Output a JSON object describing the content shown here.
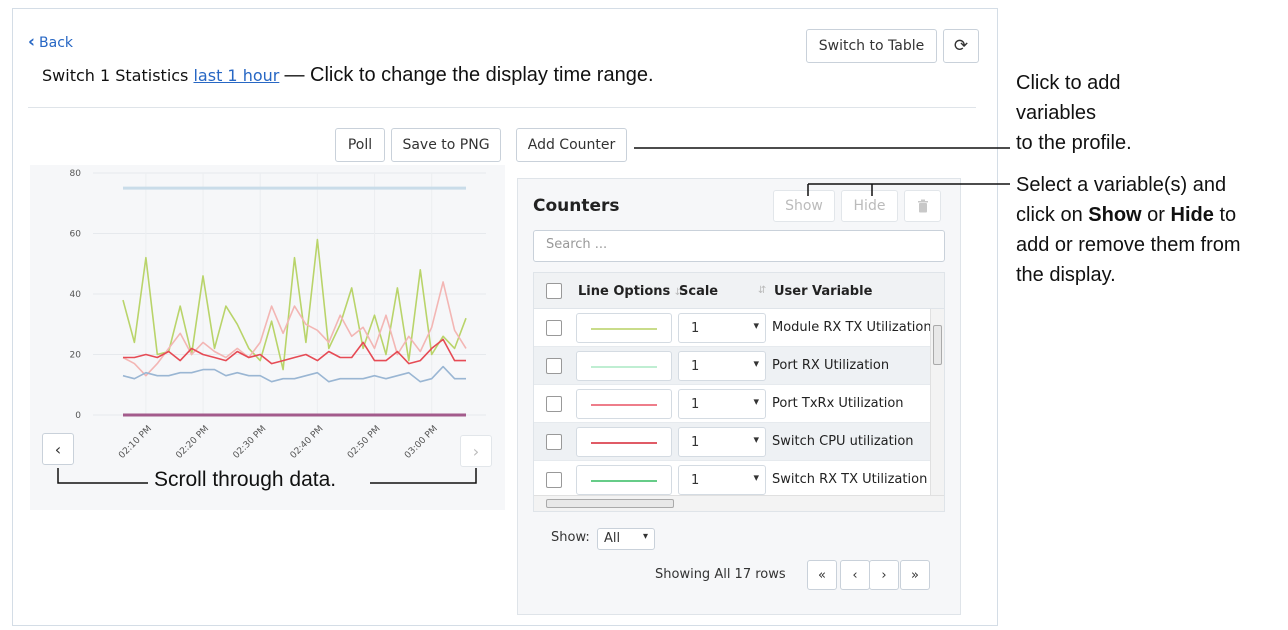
{
  "header": {
    "back_label": "Back",
    "title_prefix": "Switch 1 Statistics",
    "time_range_link": "last 1 hour",
    "time_range_note": "— Click to change the display time range.",
    "switch_view_label": "Switch to Table",
    "refresh_icon": "refresh-icon"
  },
  "toolbar": {
    "poll_label": "Poll",
    "save_png_label": "Save to PNG",
    "add_counter_label": "Add Counter"
  },
  "chart_data": {
    "type": "line",
    "x": [
      "02:05 PM",
      "02:07 PM",
      "02:09 PM",
      "02:11 PM",
      "02:13 PM",
      "02:15 PM",
      "02:17 PM",
      "02:19 PM",
      "02:21 PM",
      "02:23 PM",
      "02:25 PM",
      "02:27 PM",
      "02:29 PM",
      "02:31 PM",
      "02:33 PM",
      "02:35 PM",
      "02:37 PM",
      "02:39 PM",
      "02:41 PM",
      "02:43 PM",
      "02:45 PM",
      "02:47 PM",
      "02:49 PM",
      "02:51 PM",
      "02:53 PM",
      "02:55 PM",
      "02:57 PM",
      "02:59 PM",
      "03:01 PM",
      "03:03 PM",
      "03:05 PM"
    ],
    "x_tick_labels": [
      "02:10 PM",
      "02:20 PM",
      "02:30 PM",
      "02:40 PM",
      "02:50 PM",
      "03:00 PM"
    ],
    "y_ticks": [
      0,
      20,
      40,
      60,
      80
    ],
    "ylim": [
      0,
      80
    ],
    "grid": true,
    "series": [
      {
        "color": "#b9d46a",
        "values": [
          38,
          24,
          52,
          20,
          21,
          36,
          20,
          46,
          22,
          36,
          30,
          22,
          18,
          31,
          15,
          52,
          24,
          58,
          22,
          30,
          42,
          22,
          33,
          20,
          42,
          18,
          48,
          20,
          26,
          22,
          32
        ]
      },
      {
        "color": "#f3b6b4",
        "values": [
          19,
          17,
          13,
          17,
          22,
          27,
          20,
          24,
          21,
          19,
          22,
          19,
          24,
          36,
          27,
          36,
          30,
          28,
          24,
          33,
          26,
          29,
          22,
          33,
          20,
          26,
          21,
          29,
          44,
          28,
          22
        ]
      },
      {
        "color": "#e64b55",
        "values": [
          19,
          19,
          20,
          19,
          21,
          18,
          22,
          20,
          19,
          18,
          21,
          19,
          20,
          17,
          18,
          19,
          20,
          18,
          21,
          19,
          19,
          24,
          18,
          18,
          21,
          17,
          18,
          22,
          25,
          18,
          18
        ]
      },
      {
        "color": "#9ab6d3",
        "values": [
          13,
          12,
          14,
          13,
          13,
          14,
          14,
          15,
          15,
          13,
          14,
          13,
          13,
          11,
          12,
          12,
          13,
          14,
          11,
          12,
          12,
          12,
          13,
          12,
          13,
          14,
          11,
          12,
          16,
          12,
          12
        ]
      },
      {
        "color": "#c9dce9",
        "values": [
          75,
          75,
          75,
          75,
          75,
          75,
          75,
          75,
          75,
          75,
          75,
          75,
          75,
          75,
          75,
          75,
          75,
          75,
          75,
          75,
          75,
          75,
          75,
          75,
          75,
          75,
          75,
          75,
          75,
          75,
          75
        ]
      },
      {
        "color": "#a35b8c",
        "values": [
          0,
          0,
          0,
          0,
          0,
          0,
          0,
          0,
          0,
          0,
          0,
          0,
          0,
          0,
          0,
          0,
          0,
          0,
          0,
          0,
          0,
          0,
          0,
          0,
          0,
          0,
          0,
          0,
          0,
          0,
          0
        ]
      }
    ]
  },
  "chart_nav": {
    "prev_icon": "chevron-left-icon",
    "next_icon": "chevron-right-icon",
    "scroll_note": "Scroll through data."
  },
  "counters": {
    "title": "Counters",
    "show_label": "Show",
    "hide_label": "Hide",
    "delete_icon": "trash-icon",
    "search_placeholder": "Search ...",
    "columns": [
      "Line Options",
      "Scale",
      "User Variable"
    ],
    "rows": [
      {
        "color": "#c9dc8a",
        "scale": "1",
        "variable": "Module RX TX Utilization"
      },
      {
        "color": "#bfeed2",
        "scale": "1",
        "variable": "Port RX Utilization"
      },
      {
        "color": "#ee7d8a",
        "scale": "1",
        "variable": "Port TxRx Utilization"
      },
      {
        "color": "#e05b66",
        "scale": "1",
        "variable": "Switch CPU utilization"
      },
      {
        "color": "#66cc88",
        "scale": "1",
        "variable": "Switch RX TX Utilization"
      }
    ],
    "footer_show_label": "Show:",
    "footer_show_value": "All",
    "rows_info": "Showing All 17 rows",
    "pager": [
      "«",
      "‹",
      "›",
      "»"
    ]
  },
  "callouts": {
    "add_counter_note_line1": "Click to add",
    "add_counter_note_line2": "variables",
    "add_counter_note_line3": "to the profile.",
    "select_note_prefix": "Select a variable(s) and",
    "select_note_click_on": "click on",
    "select_note_show": "Show",
    "select_note_or": "or",
    "select_note_hide": "Hide",
    "select_note_to": "to",
    "select_note_line3": "add or remove them from",
    "select_note_line4": "the display."
  }
}
